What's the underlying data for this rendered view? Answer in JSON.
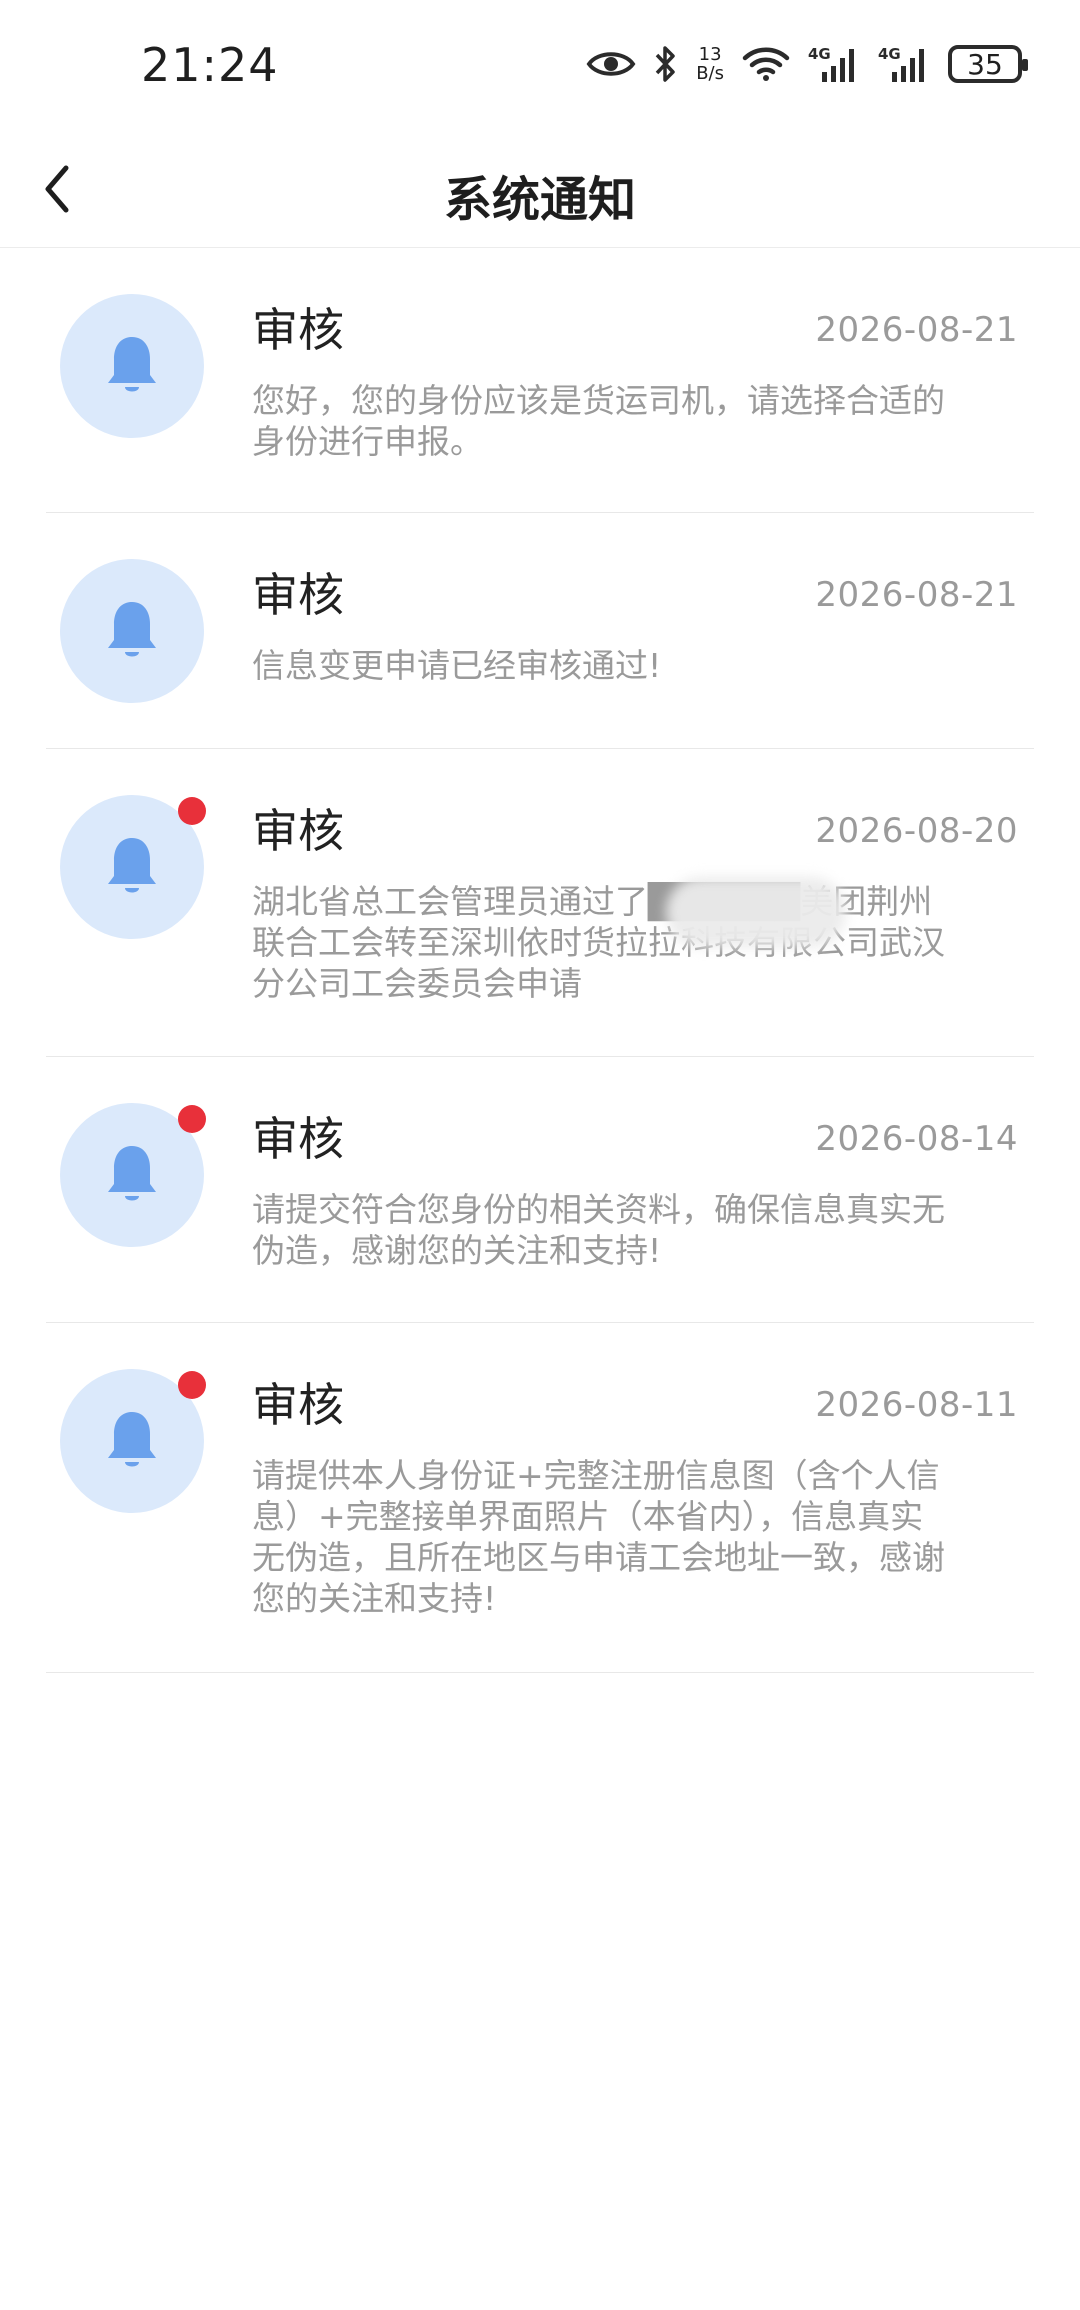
{
  "status_bar": {
    "time": "21:24",
    "net_speed_value": "13",
    "net_speed_unit": "B/s",
    "battery": "35",
    "icons": [
      "eye-icon",
      "bluetooth-icon",
      "wifi-icon",
      "signal-4g-icon",
      "signal-4g-icon",
      "battery-icon"
    ]
  },
  "header": {
    "title": "系统通知",
    "back_icon": "chevron-left-icon"
  },
  "colors": {
    "accent_bell": "#6aa1ec",
    "avatar_bg": "#dbe9fb",
    "unread_dot": "#e8303a",
    "muted_text": "#9a9a9a"
  },
  "notices": [
    {
      "title": "审核",
      "date": "2026-08-21",
      "body": "您好，您的身份应该是货运司机，请选择合适的身份进行申报。",
      "unread": false
    },
    {
      "title": "审核",
      "date": "2026-08-21",
      "body": "信息变更申请已经审核通过!",
      "unread": false
    },
    {
      "title": "审核",
      "date": "2026-08-20",
      "body": "湖北省总工会管理员通过了██████美团荆州联合工会转至深圳依时货拉拉科技有限公司武汉分公司工会委员会申请",
      "unread": true
    },
    {
      "title": "审核",
      "date": "2026-08-14",
      "body": "请提交符合您身份的相关资料，确保信息真实无伪造，感谢您的关注和支持!",
      "unread": true
    },
    {
      "title": "审核",
      "date": "2026-08-11",
      "body": "请提供本人身份证+完整注册信息图（含个人信息）+完整接单界面照片（本省内），信息真实无伪造，且所在地区与申请工会地址一致，感谢您的关注和支持!",
      "unread": true
    }
  ]
}
